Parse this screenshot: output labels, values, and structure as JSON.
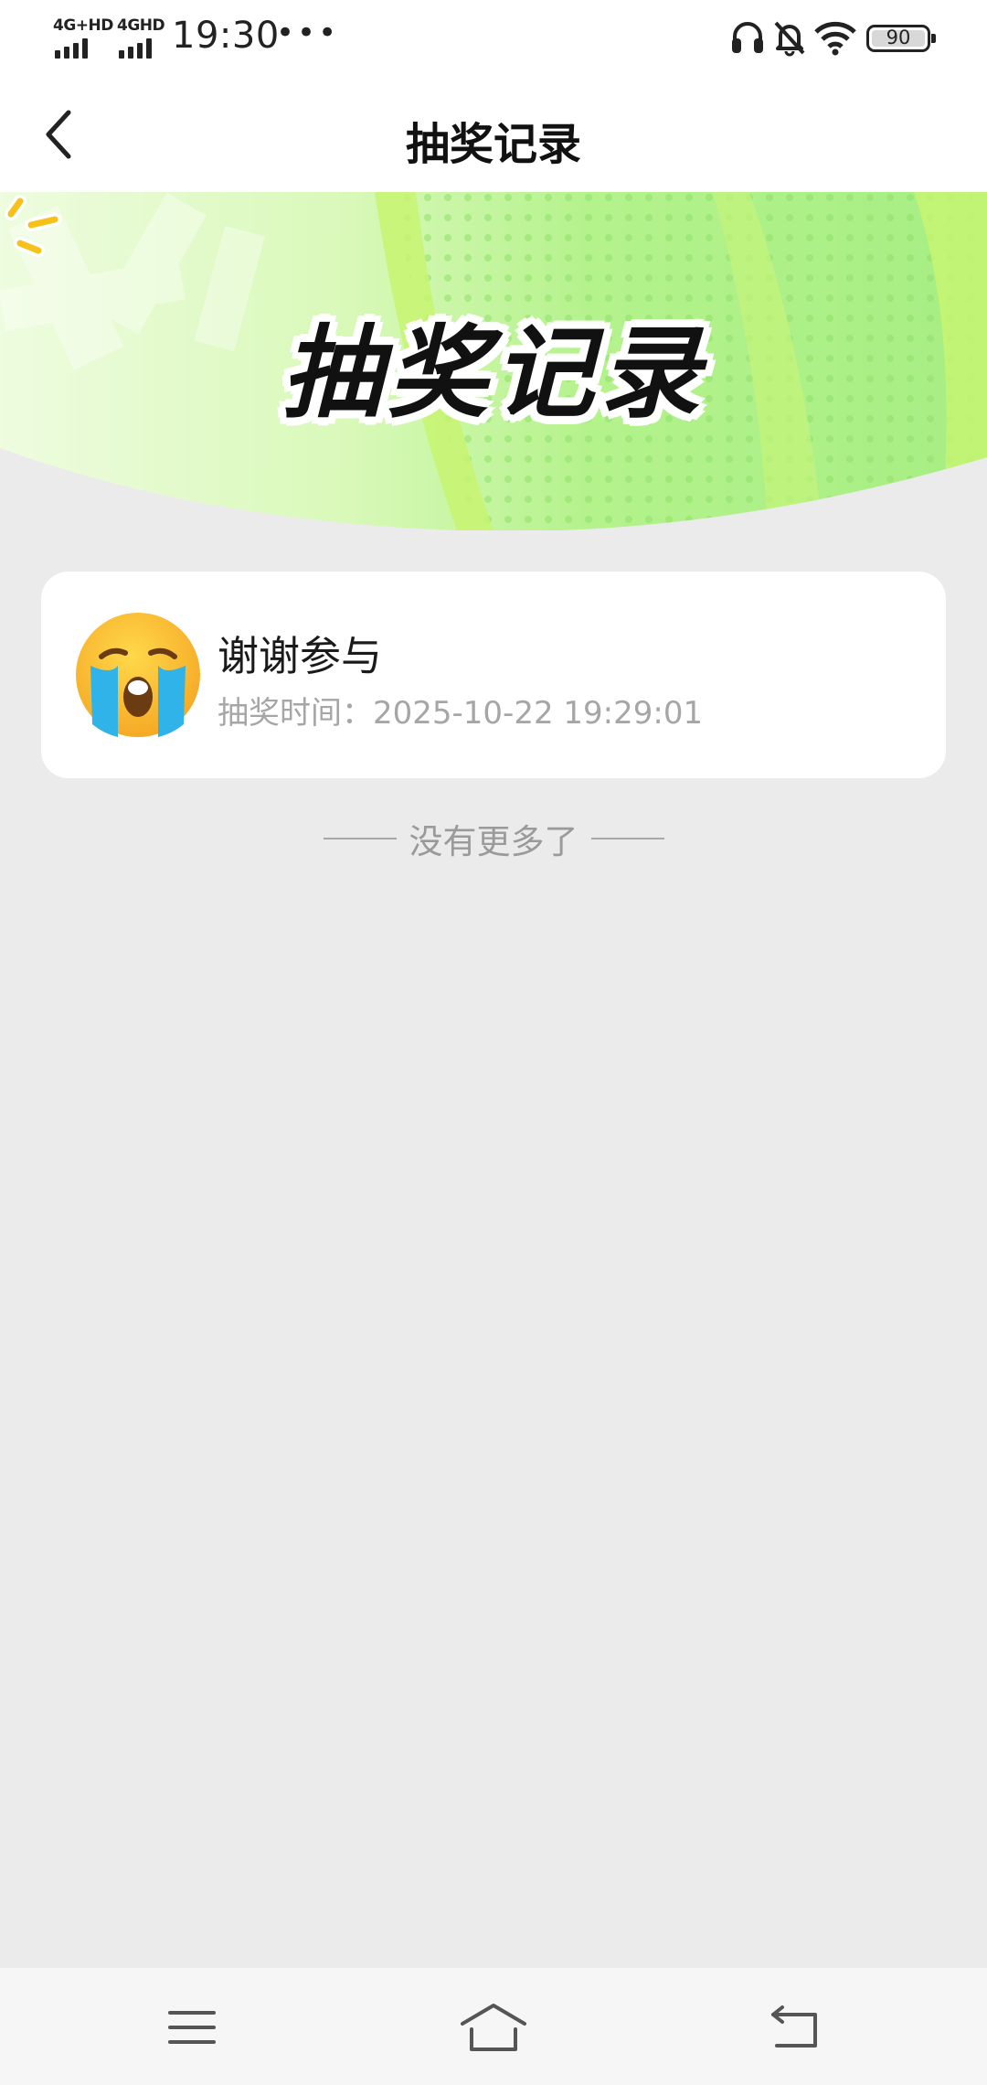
{
  "status_bar": {
    "network_1": "4G+HD",
    "network_2": "4GHD",
    "time": "19:30",
    "more": "•••",
    "battery_level": "90",
    "icons": [
      "headset-icon",
      "bell-off-icon",
      "wifi-icon",
      "battery-icon"
    ]
  },
  "nav": {
    "title": "抽奖记录",
    "back_icon": "chevron-left-icon"
  },
  "banner": {
    "title": "抽奖记录",
    "colors": {
      "light": "#e9fbd4",
      "mid": "#b7f58f",
      "accent": "#c8f571"
    }
  },
  "records": [
    {
      "icon": "crying-face-emoji",
      "prize": "谢谢参与",
      "time_label": "抽奖时间：",
      "time": "2025-10-22 19:29:01"
    }
  ],
  "list_end_text": "没有更多了",
  "system_nav": {
    "icons": [
      "menu-icon",
      "home-icon",
      "back-icon"
    ]
  }
}
